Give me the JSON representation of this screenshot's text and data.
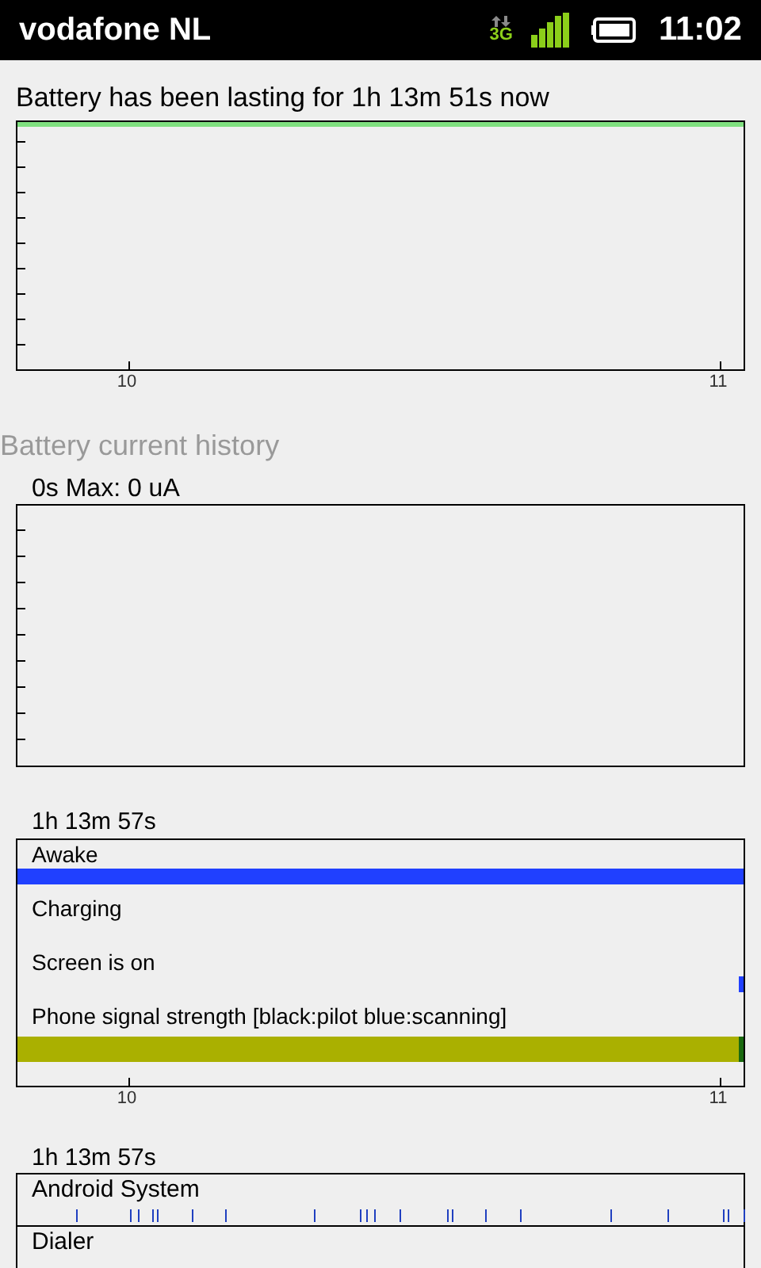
{
  "status_bar": {
    "carrier": "vodafone NL",
    "network_type": "3G",
    "time": "11:02"
  },
  "battery_chart": {
    "title": "Battery has been lasting for 1h 13m 51s now",
    "x_labels": [
      "10",
      "11"
    ]
  },
  "current_history": {
    "heading": "Battery current history",
    "caption": "0s Max: 0 uA"
  },
  "timeline": {
    "duration": "1h 13m 57s",
    "x_labels": [
      "10",
      "11"
    ],
    "rows": [
      {
        "label": "Awake",
        "kind": "full",
        "color": "#2040ff"
      },
      {
        "label": "Charging",
        "kind": "none"
      },
      {
        "label": "Screen is on",
        "kind": "end",
        "color": "#2040ff"
      },
      {
        "label": "Phone signal strength [black:pilot blue:scanning]",
        "kind": "signal",
        "color": "#aab000"
      }
    ]
  },
  "wakelocks": {
    "duration": "1h 13m 57s",
    "apps": [
      {
        "name": "Android System",
        "kind": "ticks"
      },
      {
        "name": "Dialer",
        "kind": "none"
      }
    ]
  }
}
